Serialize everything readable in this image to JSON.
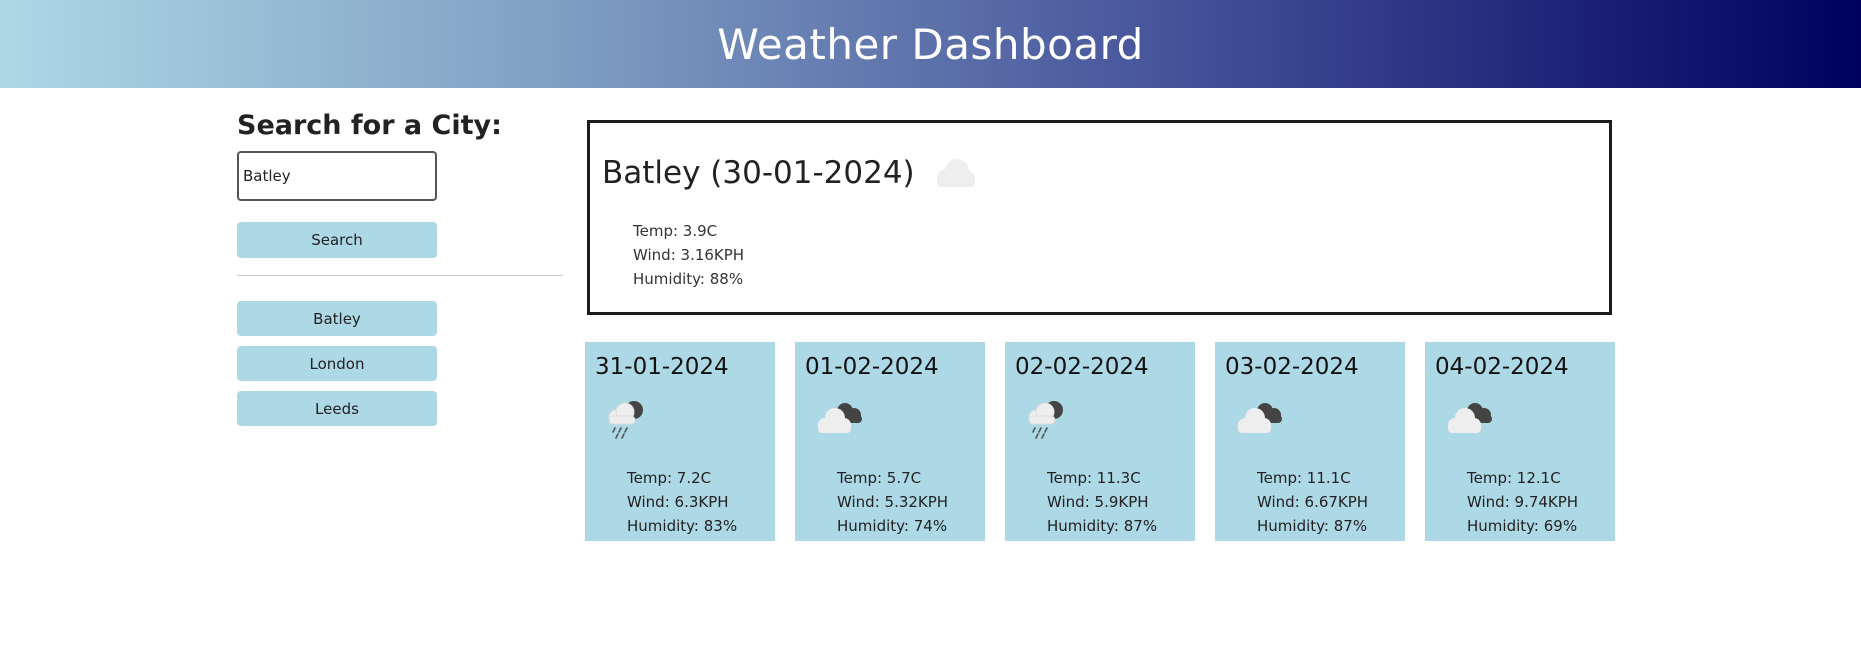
{
  "header": {
    "title": "Weather Dashboard"
  },
  "sidebar": {
    "heading": "Search for a City:",
    "input_value": "Batley",
    "search_label": "Search",
    "history": [
      "Batley",
      "London",
      "Leeds"
    ]
  },
  "current": {
    "title": "Batley (30-01-2024)",
    "icon": "cloud-icon",
    "temp": "Temp: 3.9C",
    "wind": "Wind: 3.16KPH",
    "humidity": "Humidity: 88%"
  },
  "forecast": [
    {
      "date": "31-01-2024",
      "icon": "rain-cloud-icon",
      "temp": "Temp: 7.2C",
      "wind": "Wind: 6.3KPH",
      "humidity": "Humidity: 83%"
    },
    {
      "date": "01-02-2024",
      "icon": "broken-clouds-icon",
      "temp": "Temp: 5.7C",
      "wind": "Wind: 5.32KPH",
      "humidity": "Humidity: 74%"
    },
    {
      "date": "02-02-2024",
      "icon": "rain-cloud-icon",
      "temp": "Temp: 11.3C",
      "wind": "Wind: 5.9KPH",
      "humidity": "Humidity: 87%"
    },
    {
      "date": "03-02-2024",
      "icon": "broken-clouds-icon",
      "temp": "Temp: 11.1C",
      "wind": "Wind: 6.67KPH",
      "humidity": "Humidity: 87%"
    },
    {
      "date": "04-02-2024",
      "icon": "broken-clouds-icon",
      "temp": "Temp: 12.1C",
      "wind": "Wind: 9.74KPH",
      "humidity": "Humidity: 69%"
    }
  ],
  "colors": {
    "accent": "#add8e6",
    "header_start": "#add8e6",
    "header_end": "#00005e"
  }
}
